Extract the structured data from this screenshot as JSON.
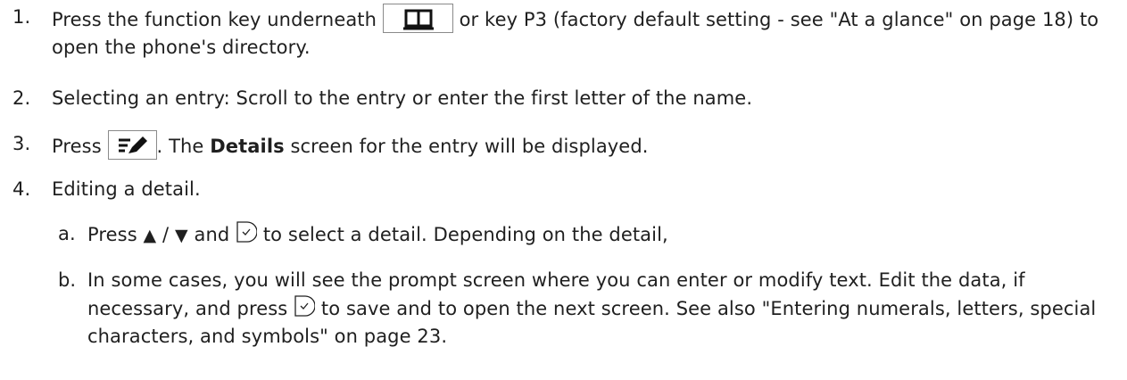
{
  "steps": {
    "s1": {
      "number": "1.",
      "pre": "Press the function key underneath ",
      "post": " or key P3 (factory default setting - see \"At a glance\" on page 18) to open the phone's directory."
    },
    "s2": {
      "number": "2.",
      "text": "Selecting an entry:  Scroll to the entry or enter the first letter of the name."
    },
    "s3": {
      "number": "3.",
      "pre": "Press ",
      "mid": ". The ",
      "bold": "Details",
      "post": " screen for the entry will be displayed."
    },
    "s4": {
      "number": "4.",
      "text": "Editing a detail."
    },
    "s4a": {
      "number": "a.",
      "pre": "Press ",
      "up_arrow": "▲",
      "slash": " / ",
      "down_arrow": "▼",
      "mid": " and ",
      "post": " to select a detail.  Depending on the detail,"
    },
    "s4b": {
      "number": "b.",
      "pre": "In some cases, you will see the prompt screen where you can enter or modify text.  Edit the data, if necessary, and press ",
      "post": " to save and to open the next screen.  See also \"Entering numerals, letters, special characters, and symbols\" on page 23."
    }
  },
  "icons": {
    "directory_key": "book-icon",
    "edit_key": "edit-details-icon",
    "ok_key": "ok-check-icon"
  }
}
